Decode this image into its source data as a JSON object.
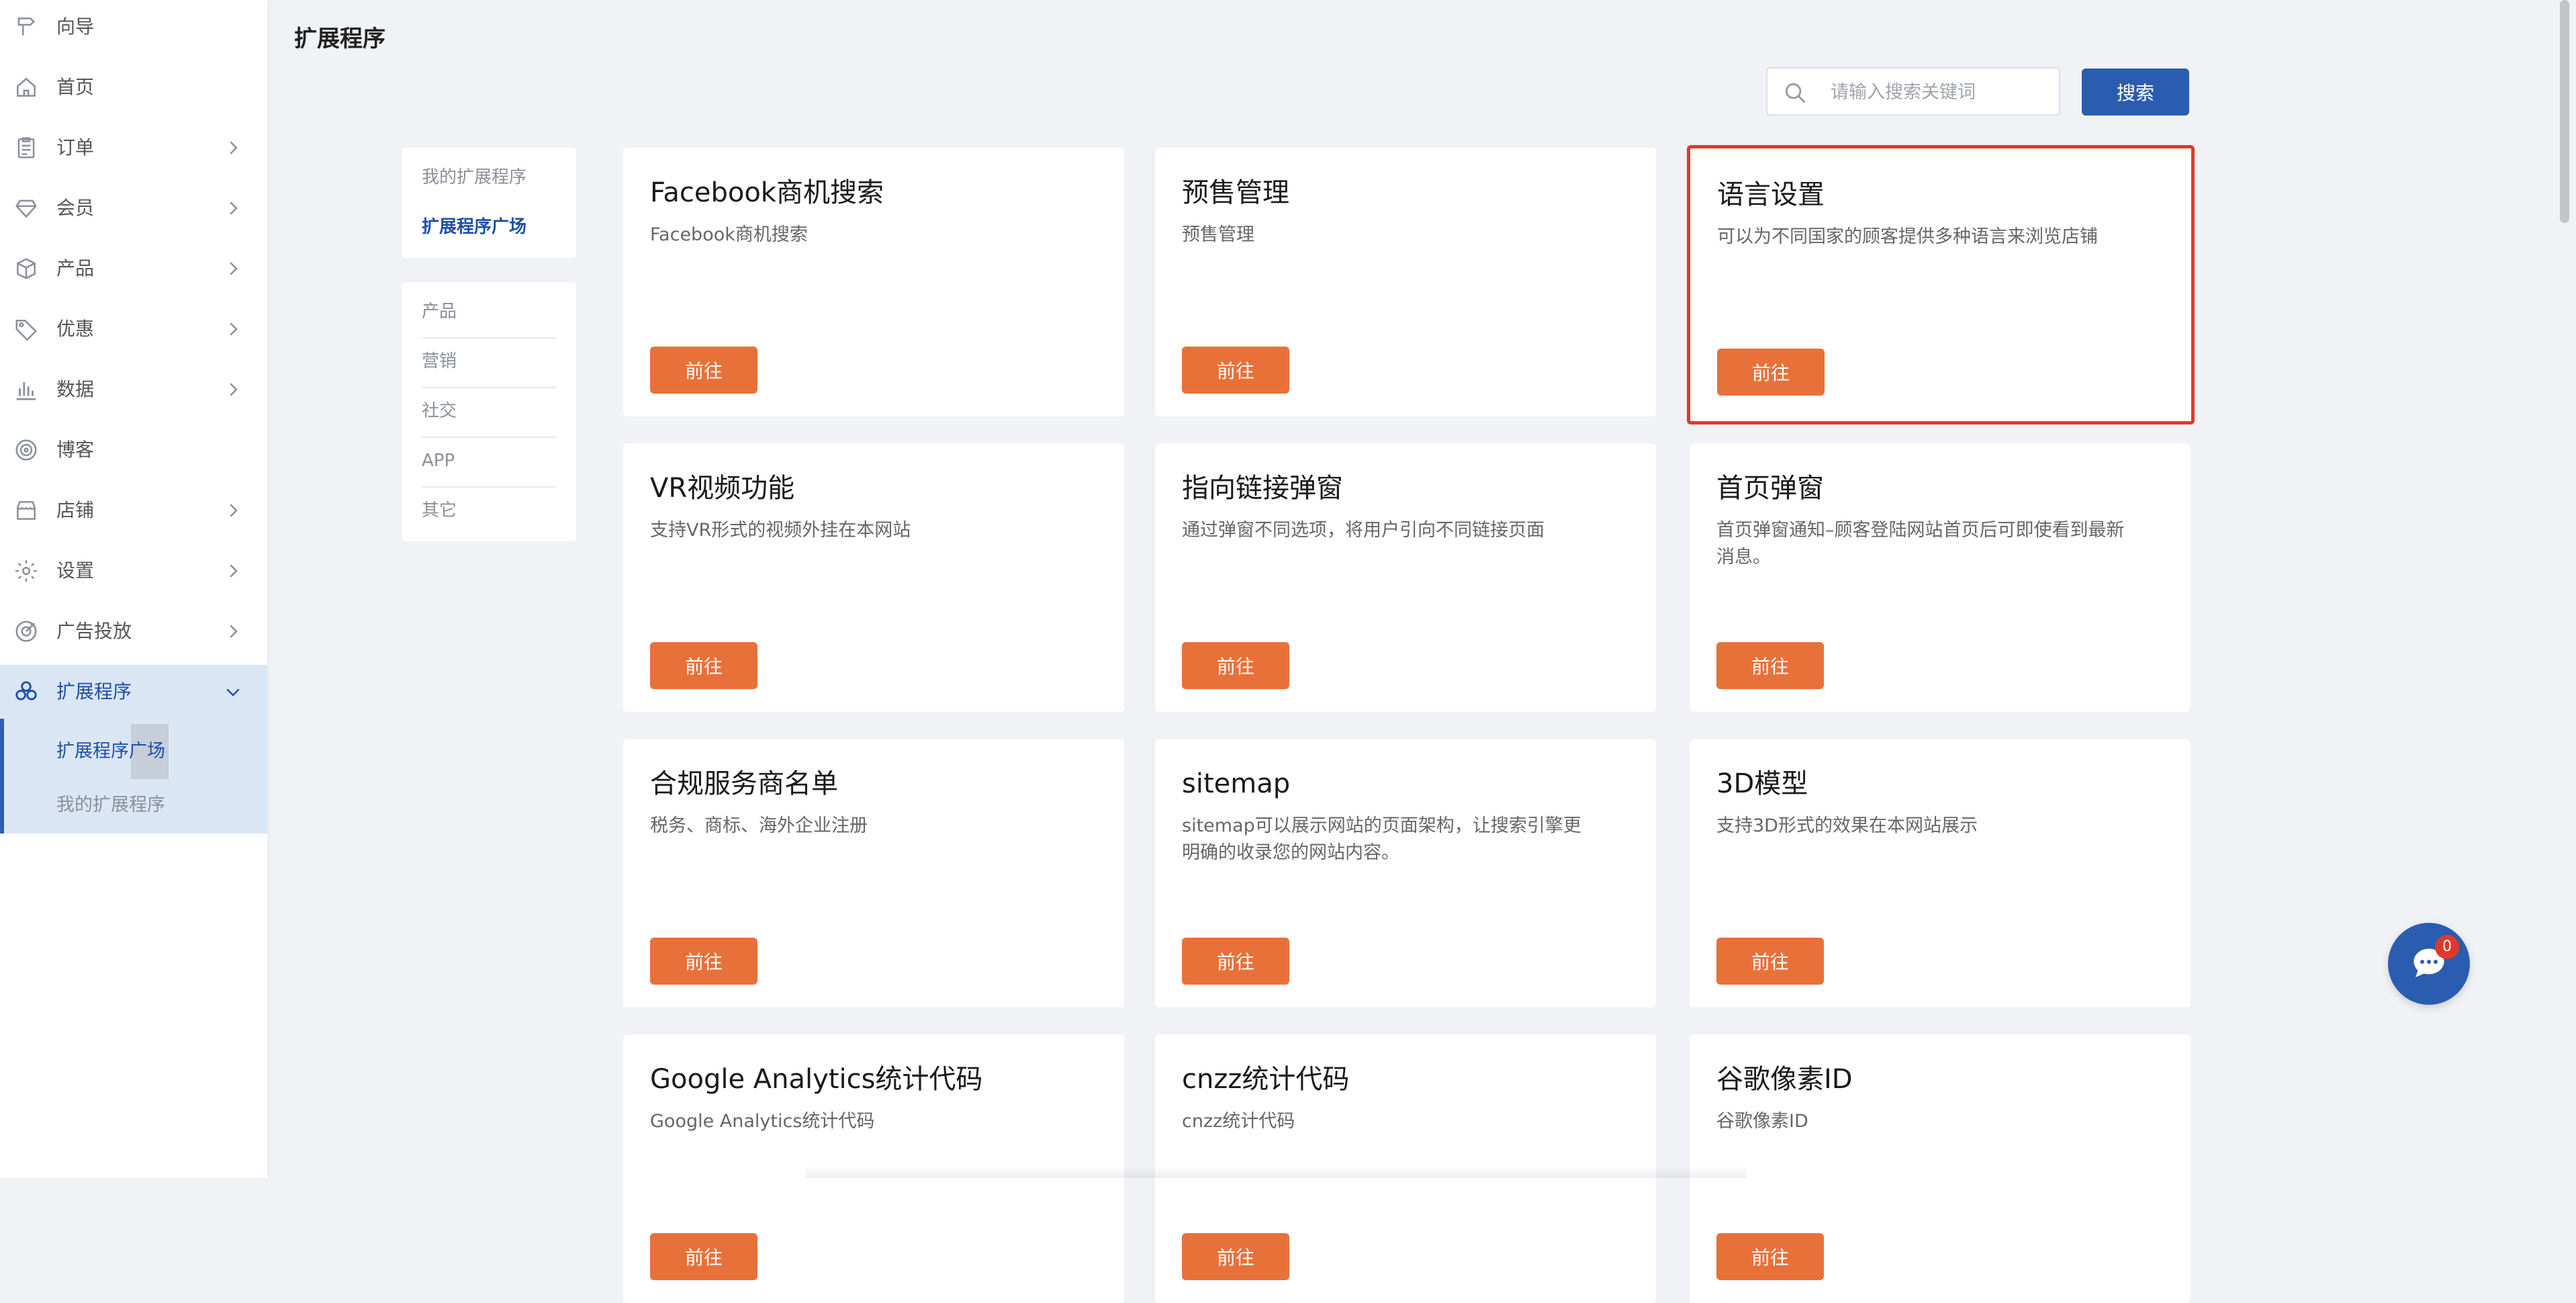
{
  "page_title": "扩展程序",
  "sidebar": {
    "items": [
      {
        "label": "向导",
        "icon": "signpost-icon",
        "has_arrow": false
      },
      {
        "label": "首页",
        "icon": "home-icon",
        "has_arrow": false
      },
      {
        "label": "订单",
        "icon": "clipboard-icon",
        "has_arrow": true
      },
      {
        "label": "会员",
        "icon": "diamond-icon",
        "has_arrow": true
      },
      {
        "label": "产品",
        "icon": "box-icon",
        "has_arrow": true
      },
      {
        "label": "优惠",
        "icon": "tag-icon",
        "has_arrow": true
      },
      {
        "label": "数据",
        "icon": "bar-chart-icon",
        "has_arrow": true
      },
      {
        "label": "博客",
        "icon": "target-icon",
        "has_arrow": false
      },
      {
        "label": "店铺",
        "icon": "store-icon",
        "has_arrow": true
      },
      {
        "label": "设置",
        "icon": "gear-icon",
        "has_arrow": true
      },
      {
        "label": "广告投放",
        "icon": "ad-target-icon",
        "has_arrow": true
      },
      {
        "label": "扩展程序",
        "icon": "extensions-icon",
        "has_arrow": true,
        "active": true,
        "expanded": true
      }
    ],
    "subitems": [
      {
        "label": "扩展程序广场",
        "active": true
      },
      {
        "label": "我的扩展程序",
        "active": false
      }
    ]
  },
  "search": {
    "placeholder": "请输入搜索关键词",
    "value": "",
    "button_label": "搜索"
  },
  "filters": {
    "top": [
      {
        "label": "我的扩展程序",
        "active": false
      },
      {
        "label": "扩展程序广场",
        "active": true
      }
    ],
    "categories": [
      "产品",
      "营销",
      "社交",
      "APP",
      "其它"
    ]
  },
  "cards": [
    {
      "title": "Facebook商机搜索",
      "desc": "Facebook商机搜索",
      "button": "前往"
    },
    {
      "title": "预售管理",
      "desc": "预售管理",
      "button": "前往"
    },
    {
      "title": "语言设置",
      "desc": "可以为不同国家的顾客提供多种语言来浏览店铺",
      "button": "前往",
      "highlighted": true
    },
    {
      "title": "VR视频功能",
      "desc": "支持VR形式的视频外挂在本网站",
      "button": "前往"
    },
    {
      "title": "指向链接弹窗",
      "desc": "通过弹窗不同选项，将用户引向不同链接页面",
      "button": "前往"
    },
    {
      "title": "首页弹窗",
      "desc": "首页弹窗通知–顾客登陆网站首页后可即使看到最新消息。",
      "button": "前往"
    },
    {
      "title": "合规服务商名单",
      "desc": "税务、商标、海外企业注册",
      "button": "前往"
    },
    {
      "title": "sitemap",
      "desc": "sitemap可以展示网站的页面架构，让搜索引擎更明确的收录您的网站内容。",
      "button": "前往"
    },
    {
      "title": "3D模型",
      "desc": "支持3D形式的效果在本网站展示",
      "button": "前往"
    },
    {
      "title": "Google Analytics统计代码",
      "desc": "Google Analytics统计代码",
      "button": "前往"
    },
    {
      "title": "cnzz统计代码",
      "desc": "cnzz统计代码",
      "button": "前往"
    },
    {
      "title": "谷歌像素ID",
      "desc": "谷歌像素ID",
      "button": "前往"
    }
  ],
  "chat": {
    "badge_count": "0"
  },
  "colors": {
    "primary": "#2a5db0",
    "accent_orange": "#e8713a",
    "highlight_red": "#e0392b",
    "sidebar_active_bg": "#dbe6f4",
    "page_bg": "#f0f2f5"
  }
}
